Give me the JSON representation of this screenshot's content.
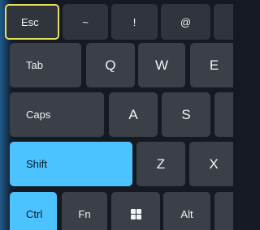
{
  "keyboard": {
    "row1": {
      "esc": "Esc",
      "tilde": "~",
      "exclam": "!",
      "at": "@"
    },
    "row2": {
      "tab": "Tab",
      "q": "Q",
      "w": "W",
      "e": "E"
    },
    "row3": {
      "caps": "Caps",
      "a": "A",
      "s": "S"
    },
    "row4": {
      "shift": "Shift",
      "z": "Z",
      "x": "X"
    },
    "row5": {
      "ctrl": "Ctrl",
      "fn": "Fn",
      "win_icon": "windows-icon",
      "alt": "Alt"
    }
  },
  "colors": {
    "key": "#3a3f48",
    "active_key": "#4cc2ff",
    "focus_outline": "#e6e05a",
    "background": "#151a22"
  },
  "state": {
    "focused_key": "Esc",
    "active_keys": [
      "Shift",
      "Ctrl"
    ]
  }
}
